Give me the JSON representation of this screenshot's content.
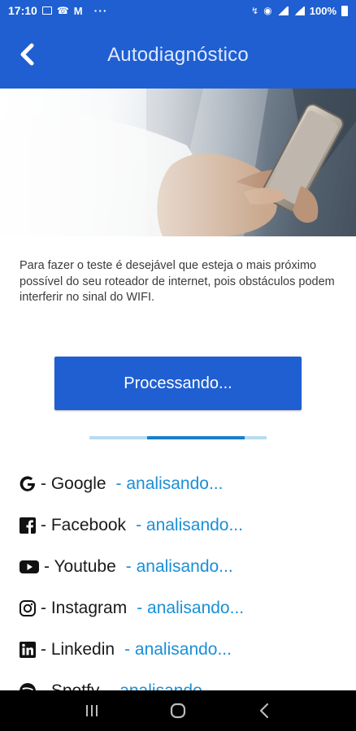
{
  "status_bar": {
    "time": "17:10",
    "battery": "100%",
    "left_icons": [
      "photo-icon",
      "tty-icon",
      "gmail-icon"
    ],
    "more": "···"
  },
  "app_bar": {
    "title": "Autodiagnóstico",
    "back_icon": "chevron-left-icon"
  },
  "hero": {
    "image": "hand-holding-smartphone-photo"
  },
  "description": "Para fazer o teste é desejável que esteja o mais próximo possível do seu roteador de internet, pois obstáculos podem interferir no sinal do WIFI.",
  "process_button": {
    "label": "Processando..."
  },
  "progress": {
    "fraction": 0.55
  },
  "services": [
    {
      "icon": "google-icon",
      "name": "- Google",
      "status": "- analisando..."
    },
    {
      "icon": "facebook-icon",
      "name": "- Facebook",
      "status": "- analisando..."
    },
    {
      "icon": "youtube-icon",
      "name": "- Youtube",
      "status": "- analisando..."
    },
    {
      "icon": "instagram-icon",
      "name": "- Instagram",
      "status": "- analisando..."
    },
    {
      "icon": "linkedin-icon",
      "name": "- Linkedin",
      "status": "- analisando..."
    },
    {
      "icon": "spotify-icon",
      "name": "- Spotfy",
      "status": "- analisando..."
    }
  ],
  "colors": {
    "primary": "#1f5fd1",
    "status_text": "#1a8fd6",
    "progress_track": "#b8dcf3",
    "progress_fill": "#1a7fc9"
  },
  "nav_bar": {
    "buttons": [
      "recent-apps-icon",
      "home-icon",
      "back-icon"
    ]
  }
}
